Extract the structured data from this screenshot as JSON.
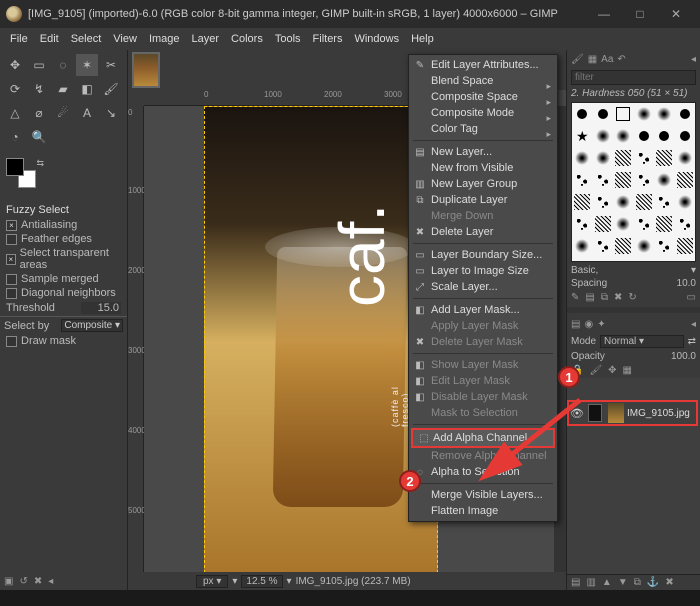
{
  "titlebar": {
    "text": "[IMG_9105] (imported)-6.0 (RGB color 8-bit gamma integer, GIMP built-in sRGB, 1 layer) 4000x6000 – GIMP",
    "min": "—",
    "max": "□",
    "close": "✕"
  },
  "menubar": [
    "File",
    "Edit",
    "Select",
    "View",
    "Image",
    "Layer",
    "Colors",
    "Tools",
    "Filters",
    "Windows",
    "Help"
  ],
  "tool_options": {
    "title": "Fuzzy Select",
    "items": [
      {
        "label": "Antialiasing",
        "checked": true
      },
      {
        "label": "Feather edges",
        "checked": false
      },
      {
        "label": "Select transparent areas",
        "checked": true
      },
      {
        "label": "Sample merged",
        "checked": false
      },
      {
        "label": "Diagonal neighbors",
        "checked": false
      }
    ],
    "threshold_label": "Threshold",
    "threshold_value": "15.0",
    "selectby_label": "Select by",
    "selectby_value": "Composite",
    "drawmask_label": "Draw mask",
    "drawmask_checked": false
  },
  "image_tab": {
    "filename": "IMG_9105.jpg"
  },
  "image_text": {
    "logo": "caf.",
    "sub": "(caffè al fresco)"
  },
  "statusbar": {
    "unit": "px",
    "zoom": "12.5 %",
    "file": "IMG_9105.jpg (223.7 MB)"
  },
  "ruler_h": [
    "0",
    "1000",
    "2000",
    "3000"
  ],
  "ruler_v": [
    "0",
    "1000",
    "2000",
    "3000",
    "4000",
    "5000"
  ],
  "right": {
    "filter_placeholder": "filter",
    "brush_name": "2. Hardness 050 (51 × 51)",
    "basic": "Basic,",
    "spacing_label": "Spacing",
    "spacing_value": "10.0",
    "mode_label": "Mode",
    "mode_value": "Normal",
    "opacity_label": "Opacity",
    "opacity_value": "100.0",
    "layer_name": "IMG_9105.jpg"
  },
  "ctx": [
    {
      "t": "Edit Layer Attributes...",
      "ic": "✎"
    },
    {
      "t": "Blend Space",
      "sub": true
    },
    {
      "t": "Composite Space",
      "sub": true
    },
    {
      "t": "Composite Mode",
      "sub": true
    },
    {
      "t": "Color Tag",
      "sub": true
    },
    "-",
    {
      "t": "New Layer...",
      "ic": "▤"
    },
    {
      "t": "New from Visible"
    },
    {
      "t": "New Layer Group",
      "ic": "▥"
    },
    {
      "t": "Duplicate Layer",
      "ic": "⧉"
    },
    {
      "t": "Merge Down",
      "dis": true
    },
    {
      "t": "Delete Layer",
      "ic": "✖"
    },
    "-",
    {
      "t": "Layer Boundary Size...",
      "ic": "▭"
    },
    {
      "t": "Layer to Image Size",
      "ic": "▭"
    },
    {
      "t": "Scale Layer...",
      "ic": "⤢"
    },
    "-",
    {
      "t": "Add Layer Mask...",
      "ic": "◧"
    },
    {
      "t": "Apply Layer Mask",
      "dis": true
    },
    {
      "t": "Delete Layer Mask",
      "dis": true,
      "ic": "✖"
    },
    "-",
    {
      "t": "Show Layer Mask",
      "dis": true,
      "ic": "◧"
    },
    {
      "t": "Edit Layer Mask",
      "dis": true,
      "ic": "◧"
    },
    {
      "t": "Disable Layer Mask",
      "dis": true,
      "ic": "◧"
    },
    {
      "t": "Mask to Selection",
      "dis": true
    },
    "-",
    {
      "t": "Add Alpha Channel",
      "hi": true,
      "ic": "⬚"
    },
    {
      "t": "Remove Alpha Channel",
      "dis": true
    },
    {
      "t": "Alpha to Selection",
      "ic": "◌"
    },
    "-",
    {
      "t": "Merge Visible Layers..."
    },
    {
      "t": "Flatten Image"
    }
  ],
  "markers": {
    "one": "1",
    "two": "2"
  }
}
